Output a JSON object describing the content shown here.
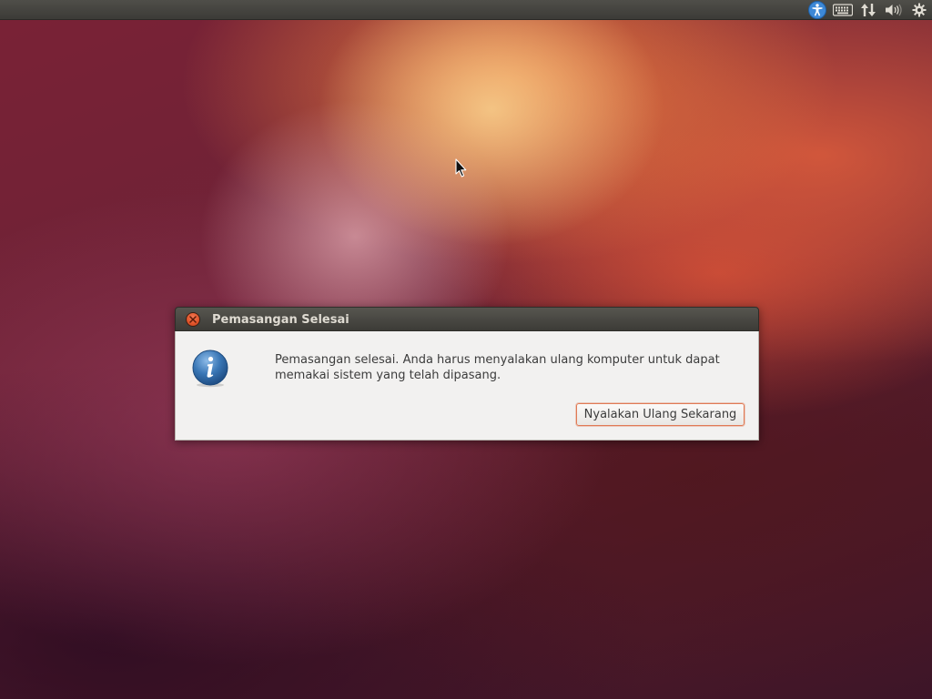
{
  "panel": {
    "indicators": [
      {
        "icon": "accessibility-icon"
      },
      {
        "icon": "keyboard-icon"
      },
      {
        "icon": "network-icon"
      },
      {
        "icon": "volume-icon"
      },
      {
        "icon": "gear-icon"
      }
    ]
  },
  "dialog": {
    "title": "Pemasangan Selesai",
    "icon": "info-icon",
    "message": "Pemasangan selesai. Anda harus menyalakan ulang komputer untuk dapat memakai sistem yang telah dipasang.",
    "restart_label": "Nyalakan Ulang Sekarang"
  },
  "colors": {
    "accent": "#e0542a",
    "panel": "#3c3b37",
    "dialog_bg": "#f2f1f0",
    "button_focus": "#e07a55",
    "info_blue": "#3a77b6"
  }
}
